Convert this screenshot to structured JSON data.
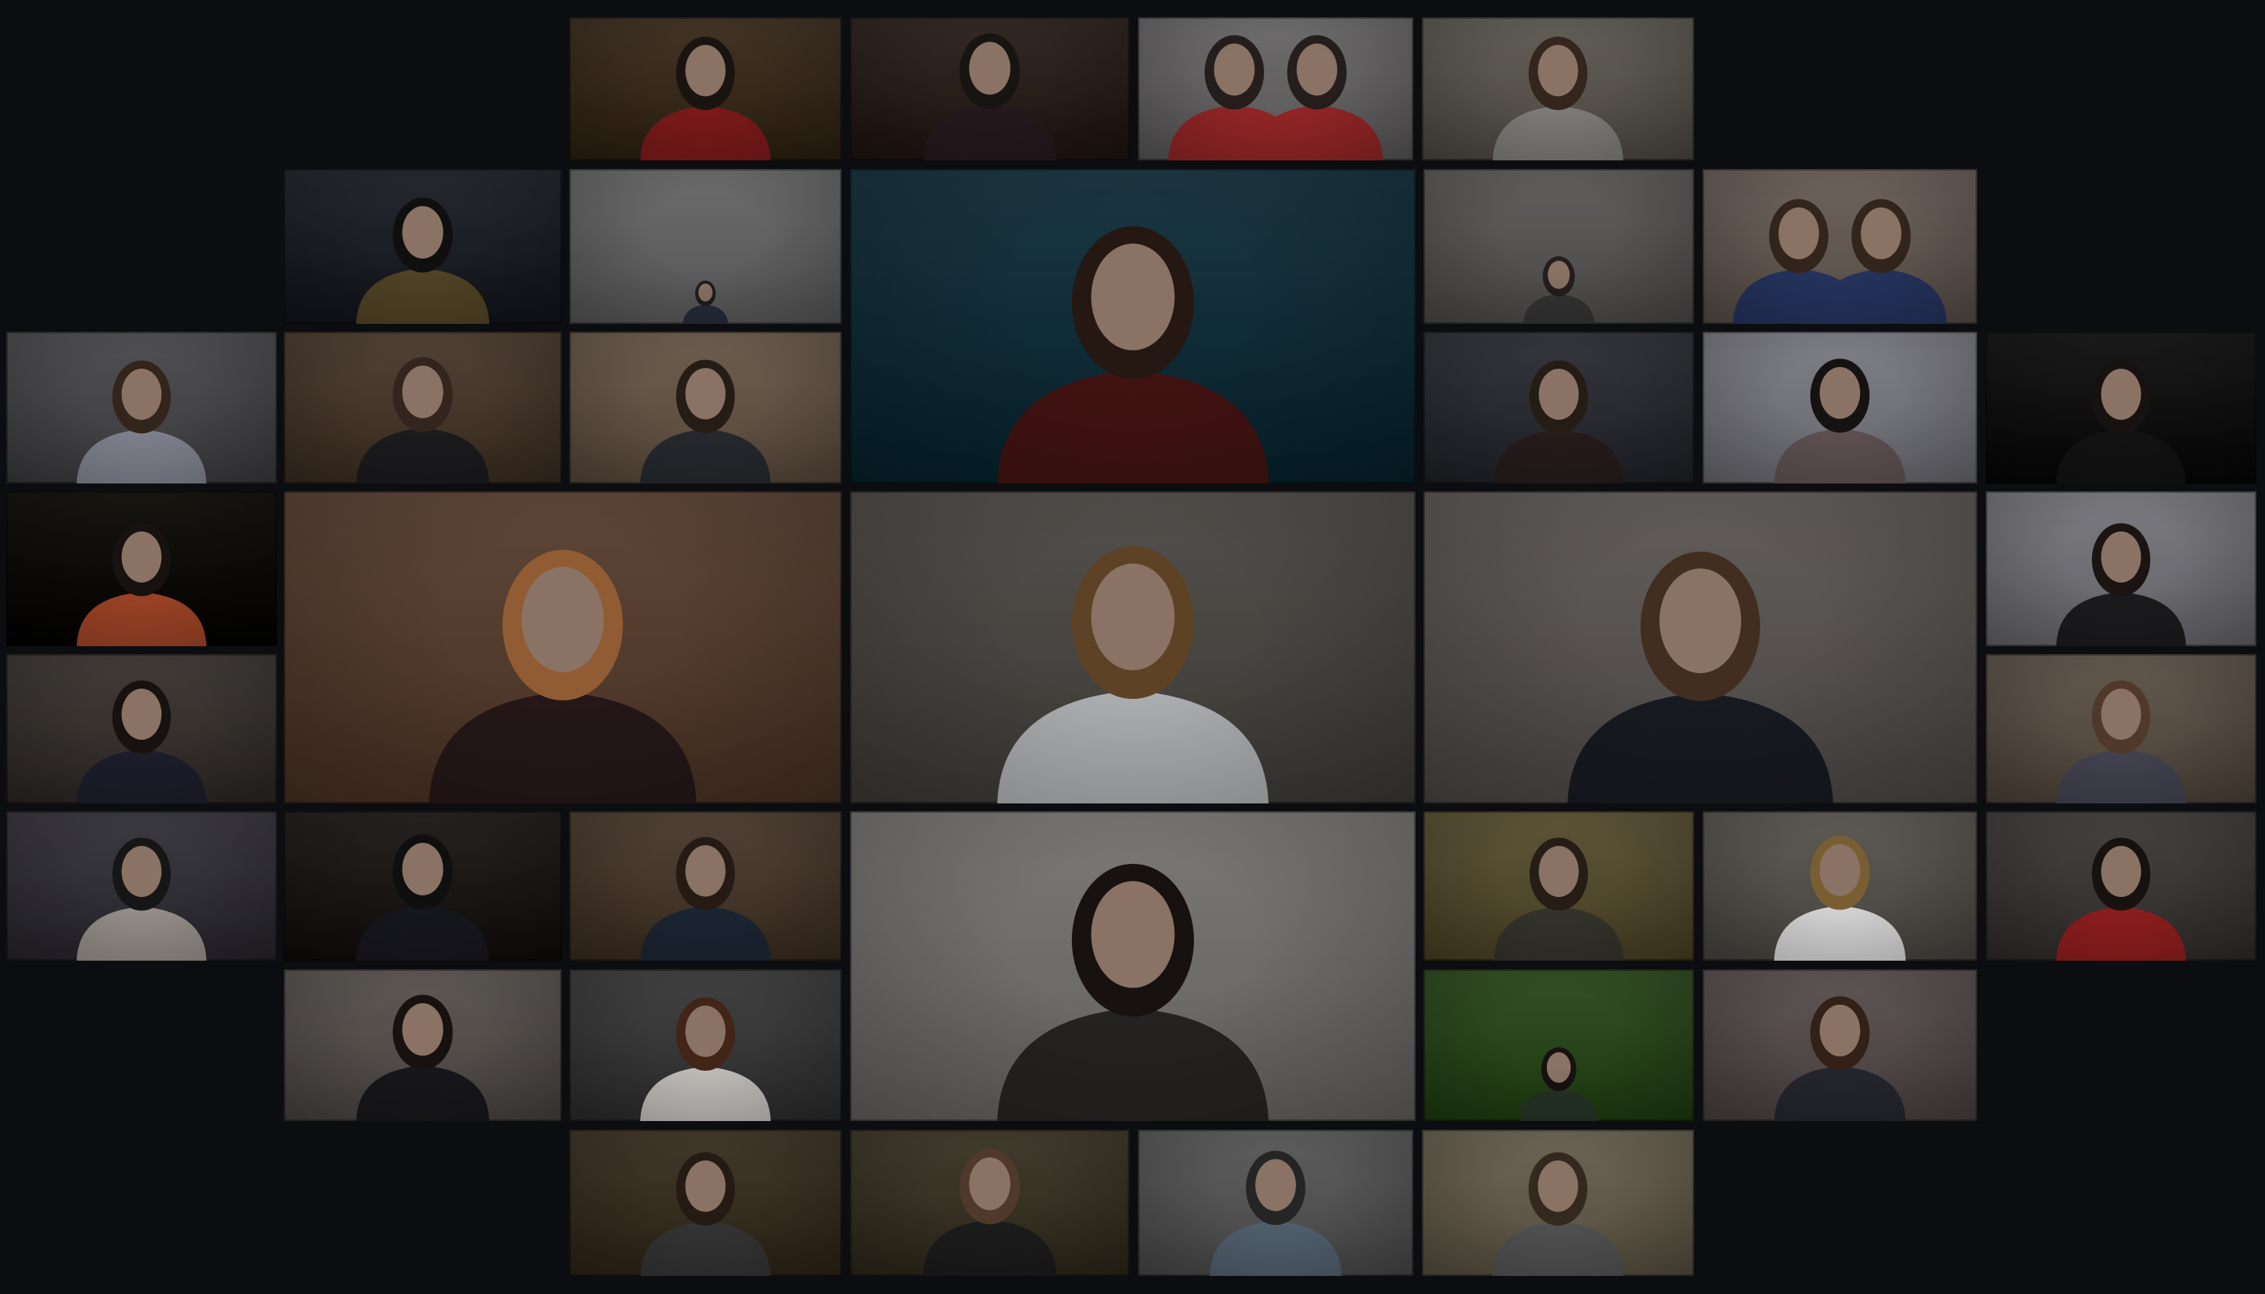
{
  "colors": {
    "background": "#0c0d10",
    "skin": "#9c8272",
    "skin_shadow": "#6e574b"
  },
  "tiles": [
    {
      "bg": "#4a3b2a",
      "shirt": "#8a1c1c",
      "hair": "#1d1612",
      "people": 1
    },
    {
      "bg": "#3a2e2a",
      "shirt": "#2a1b20",
      "hair": "#1a1614",
      "people": 1
    },
    {
      "bg": "#7d7b7c",
      "shirt": "#a52a2a",
      "hair": "#2a2220",
      "people": 2
    },
    {
      "bg": "#6f6a63",
      "shirt": "#8d8a86",
      "hair": "#3b2a20",
      "people": 1
    },
    {
      "bg": "#2b2e36",
      "shirt": "#5a4a2a",
      "hair": "#111111",
      "people": 1
    },
    {
      "bg": "#7a7a7a",
      "shirt": "#2a3040",
      "hair": "#222222",
      "people": 1,
      "scale": 0.35
    },
    {
      "bg": "#1f3e4a",
      "shirt": "#4a1414",
      "hair": "#2a1a14",
      "people": 1
    },
    {
      "bg": "#6d6b6a",
      "shirt": "#3a3a3a",
      "hair": "#2a2222",
      "people": 1,
      "scale": 0.55
    },
    {
      "bg": "#7b7068",
      "shirt": "#2a3a6a",
      "hair": "#3a2a1e",
      "people": 2
    },
    {
      "bg": "#5b5a5d",
      "shirt": "#8f92a0",
      "hair": "#3a2a1e",
      "people": 1
    },
    {
      "bg": "#5a4a3c",
      "shirt": "#1e1e22",
      "hair": "#3a2a20",
      "people": 1
    },
    {
      "bg": "#7b6a5a",
      "shirt": "#2a2e33",
      "hair": "#2a1f18",
      "people": 1
    },
    {
      "bg": "#3c3d44",
      "shirt": "#2a1e1e",
      "hair": "#2a1f18",
      "people": 1
    },
    {
      "bg": "#8f8f97",
      "shirt": "#6a5a5a",
      "hair": "#1a1414",
      "people": 1
    },
    {
      "bg": "#1e1e1e",
      "shirt": "#141414",
      "hair": "#1a1410",
      "people": 1
    },
    {
      "bg": "#1a1812",
      "shirt": "#b04a2a",
      "hair": "#1a1410",
      "people": 1
    },
    {
      "bg": "#6a5040",
      "shirt": "#2a1a1a",
      "hair": "#a4683a",
      "people": 1
    },
    {
      "bg": "#5e5a56",
      "shirt": "#c2c4c8",
      "hair": "#6a4a2a",
      "people": 1
    },
    {
      "bg": "#6e6966",
      "shirt": "#1a1d24",
      "hair": "#4a3424",
      "people": 1
    },
    {
      "bg": "#8a8a90",
      "shirt": "#1e1e22",
      "hair": "#1e1614",
      "people": 1
    },
    {
      "bg": "#4a4440",
      "shirt": "#1e2030",
      "hair": "#1a1410",
      "people": 1
    },
    {
      "bg": "#6e6458",
      "shirt": "#4a4a5a",
      "hair": "#5a4030",
      "people": 1
    },
    {
      "bg": "#44424a",
      "shirt": "#a8a09a",
      "hair": "#181818",
      "people": 1
    },
    {
      "bg": "#2a2624",
      "shirt": "#181820",
      "hair": "#101010",
      "people": 1
    },
    {
      "bg": "#5a4a3c",
      "shirt": "#1e2a38",
      "hair": "#2a1e16",
      "people": 1
    },
    {
      "bg": "#8a8886",
      "shirt": "#2a2626",
      "hair": "#1a1412",
      "people": 1
    },
    {
      "bg": "#6a6040",
      "shirt": "#3a3a30",
      "hair": "#2a2018",
      "people": 1
    },
    {
      "bg": "#6a6660",
      "shirt": "#eeeeee",
      "hair": "#8a6a3a",
      "people": 1
    },
    {
      "bg": "#4e4a48",
      "shirt": "#a02020",
      "hair": "#1a1412",
      "people": 1
    },
    {
      "bg": "#6a6460",
      "shirt": "#1a1a1e",
      "hair": "#1a1412",
      "people": 1
    },
    {
      "bg": "#4a4a4a",
      "shirt": "#d8d4d0",
      "hair": "#4a2a1a",
      "people": 1
    },
    {
      "bg": "#3a5a2a",
      "shirt": "#2a3a2a",
      "hair": "#1a1412",
      "people": 1,
      "scale": 0.6
    },
    {
      "bg": "#6a6060",
      "shirt": "#2a2a34",
      "hair": "#3a2418",
      "people": 1
    },
    {
      "bg": "#4a4030",
      "shirt": "#3a3a3a",
      "hair": "#2a1e16",
      "people": 1
    },
    {
      "bg": "#4a4434",
      "shirt": "#1e1e1e",
      "hair": "#5a4030",
      "people": 1
    },
    {
      "bg": "#6a6a6a",
      "shirt": "#5a6a7a",
      "hair": "#2a2a2a",
      "people": 1
    },
    {
      "bg": "#7a7260",
      "shirt": "#5a5a5a",
      "hair": "#3a2e22",
      "people": 1
    }
  ]
}
